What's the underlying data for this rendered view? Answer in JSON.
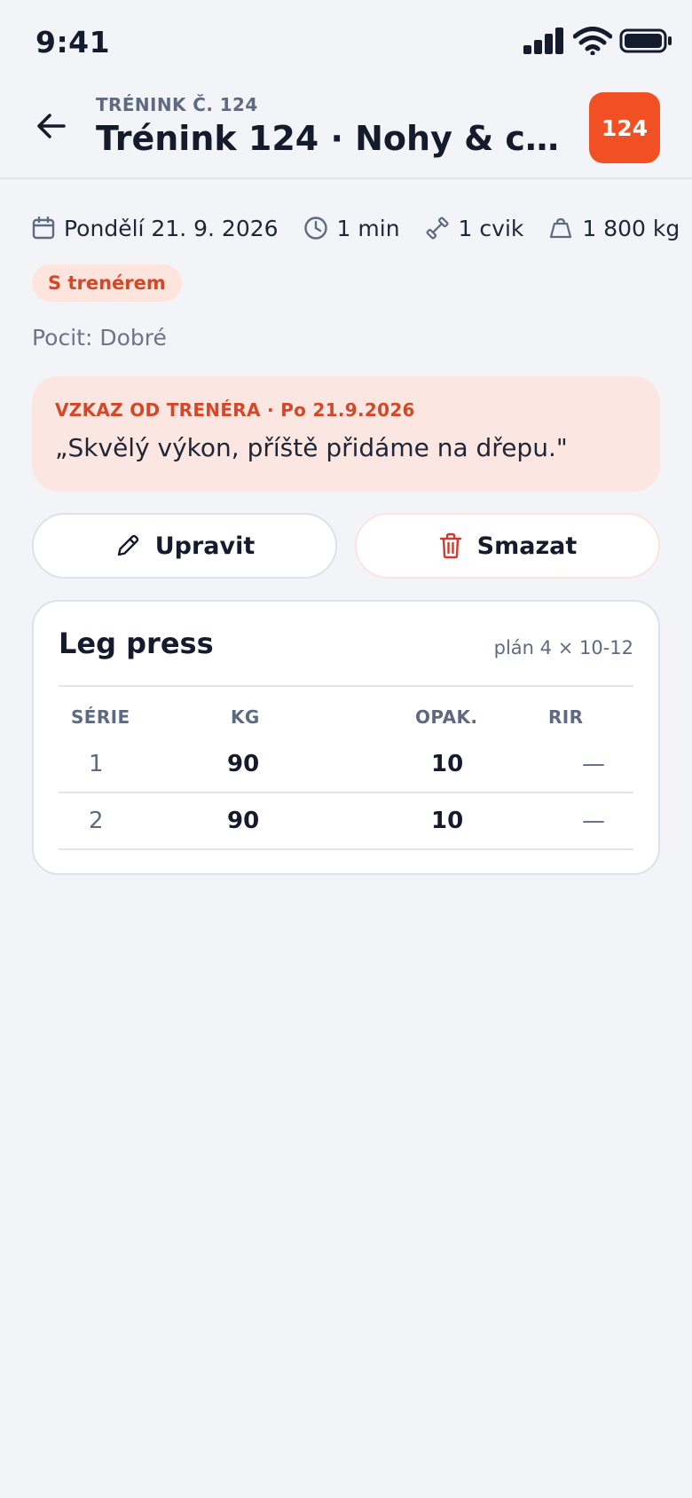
{
  "status_bar": {
    "time": "9:41",
    "icons": [
      "signal-icon",
      "wifi-icon",
      "battery-icon"
    ]
  },
  "header": {
    "kicker": "TRÉNINK Č. 124",
    "title": "Trénink 124 · Nohy & co...",
    "badge": "124",
    "badge_color": "#f05023"
  },
  "meta": {
    "date": "Pondělí 21. 9. 2026",
    "duration": "1 min",
    "exercises": "1 cvik",
    "volume": "1 800 kg"
  },
  "coach_badge": "S trenérem",
  "feeling": "Pocit: Dobré",
  "coach_message": {
    "heading": "VZKAZ OD TRENÉRA · Po 21.9.2026",
    "text": "„Skvělý výkon, příště přidáme na dřepu.\""
  },
  "actions": {
    "edit_label": "Upravit",
    "delete_label": "Smazat"
  },
  "exercise": {
    "name": "Leg press",
    "plan": "plán 4 × 10-12",
    "columns": [
      "SÉRIE",
      "KG",
      "OPAK.",
      "RIR"
    ],
    "rows": [
      {
        "set": "1",
        "kg": "90",
        "reps": "10",
        "rir": "—"
      },
      {
        "set": "2",
        "kg": "90",
        "reps": "10",
        "rir": "—"
      }
    ]
  },
  "colors": {
    "accent": "#f05023",
    "coach_accent": "#d2492a",
    "coach_bg": "#fce6e1",
    "background": "#f3f4f8"
  }
}
